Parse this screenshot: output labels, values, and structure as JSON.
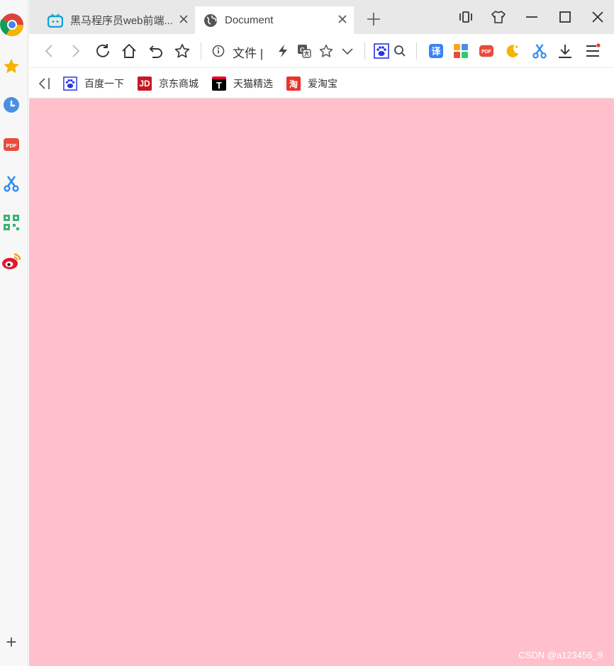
{
  "sidebar": {
    "items": [
      {
        "name": "browser-logo-icon"
      },
      {
        "name": "favorites-star-icon"
      },
      {
        "name": "history-clock-icon"
      },
      {
        "name": "pdf-icon",
        "label": "PDF"
      },
      {
        "name": "scissors-icon"
      },
      {
        "name": "qr-code-icon"
      },
      {
        "name": "weibo-icon"
      }
    ],
    "add_label": "+"
  },
  "tabs": [
    {
      "title": "黑马程序员web前端...",
      "active": false
    },
    {
      "title": "Document",
      "active": true
    }
  ],
  "toolbar": {
    "address_label": "文件 |",
    "translate_label": "译",
    "pdf_label": "PDF"
  },
  "bookmarks": [
    {
      "label": "百度一下",
      "icon": "baidu-icon",
      "color": "#2932e1"
    },
    {
      "label": "京东商城",
      "icon": "jd-icon",
      "icon_text": "JD",
      "color": "#c91623"
    },
    {
      "label": "天猫精选",
      "icon": "tmall-icon",
      "icon_text": "T",
      "color": "#e4002b"
    },
    {
      "label": "爱淘宝",
      "icon": "taobao-icon",
      "icon_text": "淘",
      "color": "#e8352b"
    }
  ],
  "page": {
    "background": "#ffc0cb"
  },
  "watermark": "CSDN @a123456_9",
  "colors": {
    "tab_strip": "#e8e8e8",
    "accent_blue": "#3b82f6",
    "notification_red": "#e53935"
  }
}
